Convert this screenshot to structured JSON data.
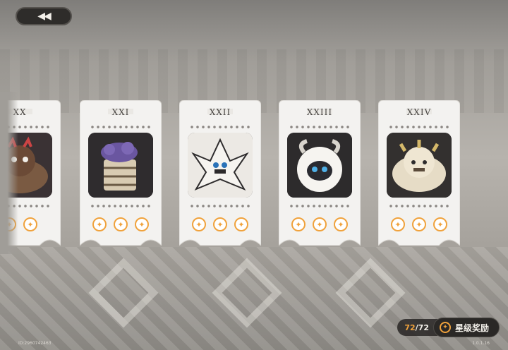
{
  "header": {
    "back_icon": "double-chevron-left"
  },
  "cards": [
    {
      "numeral": "XX",
      "creature": "brown-furry-beast",
      "stars_earned": 2,
      "stars_total": 2
    },
    {
      "numeral": "XXI",
      "creature": "purple-rock-barrel",
      "stars_earned": 3,
      "stars_total": 3
    },
    {
      "numeral": "XXII",
      "creature": "white-spiky-beast",
      "stars_earned": 3,
      "stars_total": 3
    },
    {
      "numeral": "XXIII",
      "creature": "white-fluffy-ram",
      "stars_earned": 3,
      "stars_total": 3
    },
    {
      "numeral": "XXIV",
      "creature": "cream-horned-beast",
      "stars_earned": 3,
      "stars_total": 3
    }
  ],
  "footer": {
    "id_text": "ID:2960742463",
    "version": "1.0.1.16",
    "star_count_current": "72",
    "star_count_sep": "/",
    "star_count_total": "72",
    "reward_label": "星级奖励"
  },
  "colors": {
    "star_accent": "#f0a23c",
    "card_bg": "#f3f2f0"
  }
}
